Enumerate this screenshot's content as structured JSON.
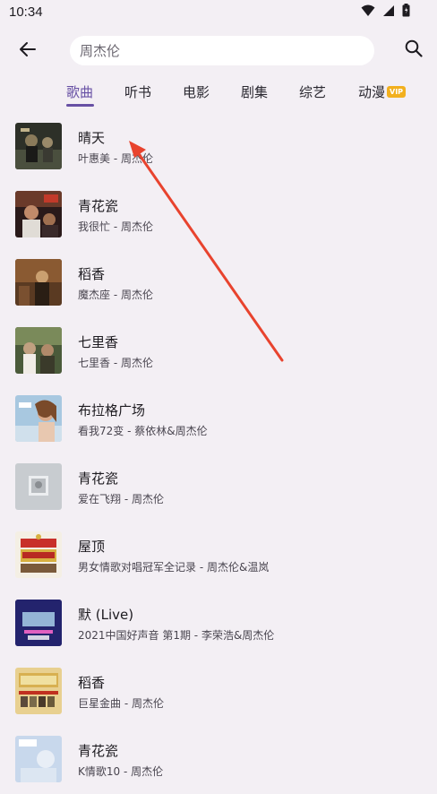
{
  "status_bar": {
    "time": "10:34"
  },
  "search": {
    "value": "周杰伦"
  },
  "tabs": [
    {
      "label": "歌曲",
      "active": true
    },
    {
      "label": "听书",
      "active": false
    },
    {
      "label": "电影",
      "active": false
    },
    {
      "label": "剧集",
      "active": false
    },
    {
      "label": "综艺",
      "active": false
    },
    {
      "label": "动漫",
      "active": false,
      "badge": "VIP"
    }
  ],
  "songs": [
    {
      "title": "晴天",
      "subtitle": "叶惠美 - 周杰伦"
    },
    {
      "title": "青花瓷",
      "subtitle": "我很忙 - 周杰伦"
    },
    {
      "title": "稻香",
      "subtitle": "魔杰座 - 周杰伦"
    },
    {
      "title": "七里香",
      "subtitle": "七里香 - 周杰伦"
    },
    {
      "title": "布拉格广场",
      "subtitle": "看我72变 - 蔡依林&周杰伦"
    },
    {
      "title": "青花瓷",
      "subtitle": "爱在飞翔 - 周杰伦"
    },
    {
      "title": "屋顶",
      "subtitle": "男女情歌对唱冠军全记录 - 周杰伦&温岚"
    },
    {
      "title": "默 (Live)",
      "subtitle": "2021中国好声音 第1期 - 李荣浩&周杰伦"
    },
    {
      "title": "稻香",
      "subtitle": "巨星金曲 - 周杰伦"
    },
    {
      "title": "青花瓷",
      "subtitle": "K情歌10 - 周杰伦"
    }
  ],
  "colors": {
    "background": "#f3eff4",
    "accent": "#6750a4",
    "vip_badge": "#f2b01e",
    "annotation_arrow": "#e8432e"
  },
  "icons": {
    "back": "arrow-left-icon",
    "search": "search-icon",
    "wifi": "wifi-icon",
    "signal": "cell-signal-icon",
    "battery": "battery-icon"
  }
}
